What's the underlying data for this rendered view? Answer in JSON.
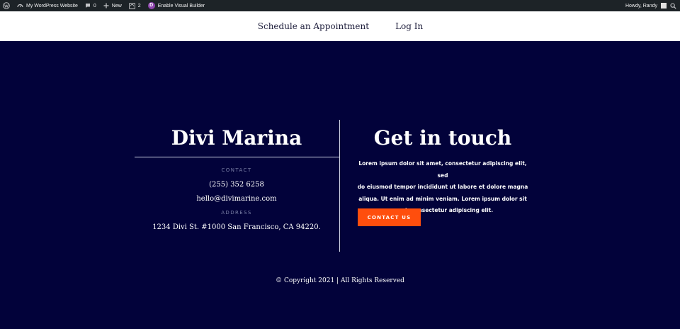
{
  "adminbar": {
    "site_name": "My WordPress Website",
    "comments_count": "0",
    "new_label": "New",
    "updates_count": "2",
    "visual_builder_label": "Enable Visual Builder",
    "greeting": "Howdy, Randy"
  },
  "nav": {
    "items": [
      {
        "label": "Schedule an Appointment"
      },
      {
        "label": "Log In"
      }
    ]
  },
  "left": {
    "title": "Divi Marina",
    "contact_label": "CONTACT",
    "phone": "(255) 352  6258",
    "email": "hello@divimarine.com",
    "address_label": "ADDRESS",
    "address": "1234 Divi St. #1000 San Francisco, CA 94220."
  },
  "right": {
    "title": "Get in touch",
    "lines": [
      "Lorem ipsum dolor sit amet, consectetur adipiscing elit, sed",
      "do eiusmod tempor incididunt ut labore et dolore magna",
      "aliqua. Ut enim ad minim veniam. Lorem ipsum dolor sit",
      "amet, consectetur adipiscing elit."
    ],
    "button_label": "CONTACT US"
  },
  "footer": {
    "copyright": "© Copyright 2021 | All Rights Reserved"
  },
  "colors": {
    "background": "#02023a",
    "accent": "#ff4e0d",
    "adminbar": "#1d2327"
  },
  "icons": {
    "wordpress": "wordpress-icon",
    "dashboard": "dashboard-icon",
    "comment": "comment-icon",
    "plus": "plus-icon",
    "updates": "updates-icon",
    "divi": "divi-icon",
    "search": "search-icon"
  }
}
